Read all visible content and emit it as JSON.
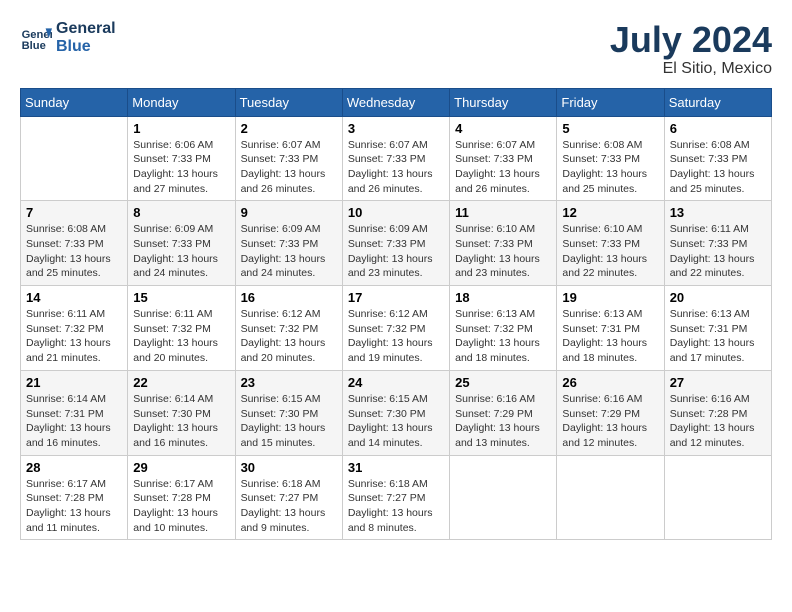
{
  "header": {
    "logo_line1": "General",
    "logo_line2": "Blue",
    "month_year": "July 2024",
    "location": "El Sitio, Mexico"
  },
  "calendar": {
    "days_of_week": [
      "Sunday",
      "Monday",
      "Tuesday",
      "Wednesday",
      "Thursday",
      "Friday",
      "Saturday"
    ],
    "weeks": [
      [
        {
          "day": "",
          "info": ""
        },
        {
          "day": "1",
          "info": "Sunrise: 6:06 AM\nSunset: 7:33 PM\nDaylight: 13 hours\nand 27 minutes."
        },
        {
          "day": "2",
          "info": "Sunrise: 6:07 AM\nSunset: 7:33 PM\nDaylight: 13 hours\nand 26 minutes."
        },
        {
          "day": "3",
          "info": "Sunrise: 6:07 AM\nSunset: 7:33 PM\nDaylight: 13 hours\nand 26 minutes."
        },
        {
          "day": "4",
          "info": "Sunrise: 6:07 AM\nSunset: 7:33 PM\nDaylight: 13 hours\nand 26 minutes."
        },
        {
          "day": "5",
          "info": "Sunrise: 6:08 AM\nSunset: 7:33 PM\nDaylight: 13 hours\nand 25 minutes."
        },
        {
          "day": "6",
          "info": "Sunrise: 6:08 AM\nSunset: 7:33 PM\nDaylight: 13 hours\nand 25 minutes."
        }
      ],
      [
        {
          "day": "7",
          "info": ""
        },
        {
          "day": "8",
          "info": "Sunrise: 6:09 AM\nSunset: 7:33 PM\nDaylight: 13 hours\nand 24 minutes."
        },
        {
          "day": "9",
          "info": "Sunrise: 6:09 AM\nSunset: 7:33 PM\nDaylight: 13 hours\nand 24 minutes."
        },
        {
          "day": "10",
          "info": "Sunrise: 6:09 AM\nSunset: 7:33 PM\nDaylight: 13 hours\nand 23 minutes."
        },
        {
          "day": "11",
          "info": "Sunrise: 6:10 AM\nSunset: 7:33 PM\nDaylight: 13 hours\nand 23 minutes."
        },
        {
          "day": "12",
          "info": "Sunrise: 6:10 AM\nSunset: 7:33 PM\nDaylight: 13 hours\nand 22 minutes."
        },
        {
          "day": "13",
          "info": "Sunrise: 6:11 AM\nSunset: 7:33 PM\nDaylight: 13 hours\nand 22 minutes."
        }
      ],
      [
        {
          "day": "14",
          "info": ""
        },
        {
          "day": "15",
          "info": "Sunrise: 6:11 AM\nSunset: 7:32 PM\nDaylight: 13 hours\nand 20 minutes."
        },
        {
          "day": "16",
          "info": "Sunrise: 6:12 AM\nSunset: 7:32 PM\nDaylight: 13 hours\nand 20 minutes."
        },
        {
          "day": "17",
          "info": "Sunrise: 6:12 AM\nSunset: 7:32 PM\nDaylight: 13 hours\nand 19 minutes."
        },
        {
          "day": "18",
          "info": "Sunrise: 6:13 AM\nSunset: 7:32 PM\nDaylight: 13 hours\nand 18 minutes."
        },
        {
          "day": "19",
          "info": "Sunrise: 6:13 AM\nSunset: 7:31 PM\nDaylight: 13 hours\nand 18 minutes."
        },
        {
          "day": "20",
          "info": "Sunrise: 6:13 AM\nSunset: 7:31 PM\nDaylight: 13 hours\nand 17 minutes."
        }
      ],
      [
        {
          "day": "21",
          "info": ""
        },
        {
          "day": "22",
          "info": "Sunrise: 6:14 AM\nSunset: 7:30 PM\nDaylight: 13 hours\nand 16 minutes."
        },
        {
          "day": "23",
          "info": "Sunrise: 6:15 AM\nSunset: 7:30 PM\nDaylight: 13 hours\nand 15 minutes."
        },
        {
          "day": "24",
          "info": "Sunrise: 6:15 AM\nSunset: 7:30 PM\nDaylight: 13 hours\nand 14 minutes."
        },
        {
          "day": "25",
          "info": "Sunrise: 6:16 AM\nSunset: 7:29 PM\nDaylight: 13 hours\nand 13 minutes."
        },
        {
          "day": "26",
          "info": "Sunrise: 6:16 AM\nSunset: 7:29 PM\nDaylight: 13 hours\nand 12 minutes."
        },
        {
          "day": "27",
          "info": "Sunrise: 6:16 AM\nSunset: 7:28 PM\nDaylight: 13 hours\nand 12 minutes."
        }
      ],
      [
        {
          "day": "28",
          "info": "Sunrise: 6:17 AM\nSunset: 7:28 PM\nDaylight: 13 hours\nand 11 minutes."
        },
        {
          "day": "29",
          "info": "Sunrise: 6:17 AM\nSunset: 7:28 PM\nDaylight: 13 hours\nand 10 minutes."
        },
        {
          "day": "30",
          "info": "Sunrise: 6:18 AM\nSunset: 7:27 PM\nDaylight: 13 hours\nand 9 minutes."
        },
        {
          "day": "31",
          "info": "Sunrise: 6:18 AM\nSunset: 7:27 PM\nDaylight: 13 hours\nand 8 minutes."
        },
        {
          "day": "",
          "info": ""
        },
        {
          "day": "",
          "info": ""
        },
        {
          "day": "",
          "info": ""
        }
      ]
    ],
    "week1_sunday_info": "Sunrise: 6:08 AM\nSunset: 7:33 PM\nDaylight: 13 hours\nand 25 minutes.",
    "week2_sunday_info": "Sunrise: 6:08 AM\nSunset: 7:33 PM\nDaylight: 13 hours\nand 25 minutes.",
    "week3_sunday_info": "Sunrise: 6:11 AM\nSunset: 7:32 PM\nDaylight: 13 hours\nand 21 minutes.",
    "week4_sunday_info": "Sunrise: 6:14 AM\nSunset: 7:31 PM\nDaylight: 13 hours\nand 16 minutes."
  }
}
